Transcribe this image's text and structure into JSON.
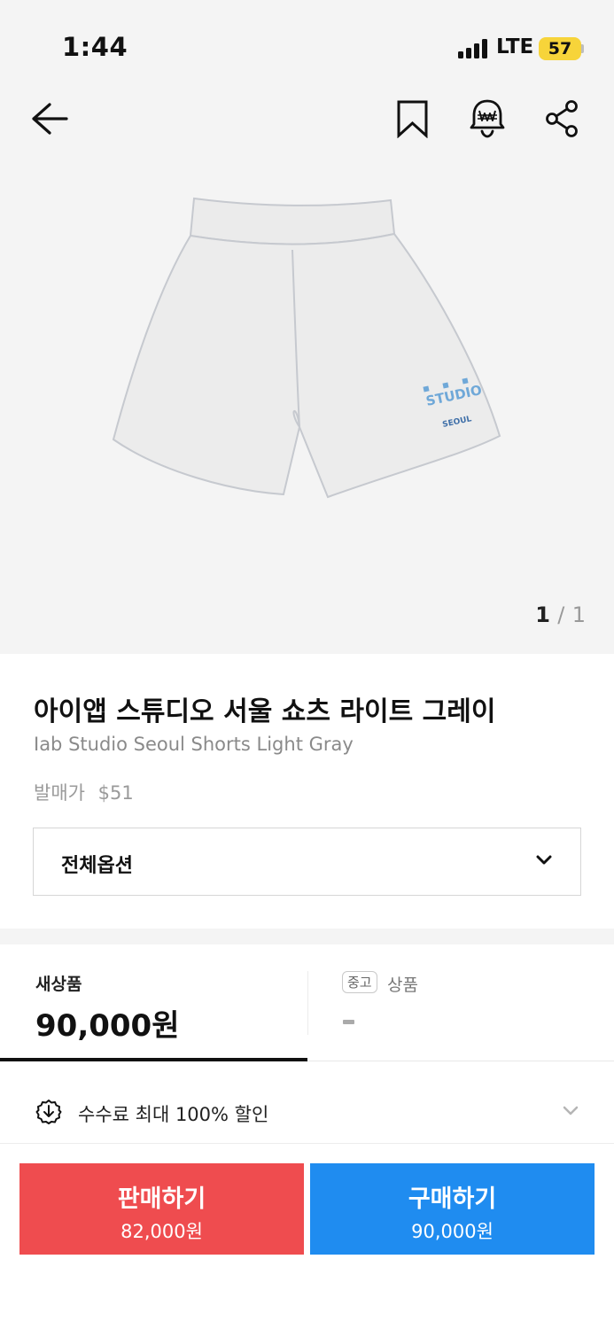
{
  "status_bar": {
    "time": "1:44",
    "network": "LTE",
    "battery": "57"
  },
  "nav": {
    "back_icon": "arrow-left-icon",
    "bookmark_icon": "bookmark-icon",
    "alert_icon": "price-alert-bell-icon",
    "share_icon": "share-icon"
  },
  "gallery": {
    "current": "1",
    "separator": "/",
    "total": "1",
    "image": "light-gray-shorts-photo",
    "print_text": "STUDIO",
    "print_sub": "SEOUL"
  },
  "product": {
    "title_ko": "아이앱 스튜디오 서울 쇼츠 라이트 그레이",
    "title_en": "Iab Studio Seoul Shorts Light Gray",
    "release_label": "발매가",
    "release_price": "$51"
  },
  "options": {
    "label": "전체옵션",
    "icon": "chevron-down-icon"
  },
  "tabs": {
    "new": {
      "label": "새상품",
      "price": "90,000원"
    },
    "used": {
      "badge": "중고",
      "label": "상품",
      "price": "-"
    }
  },
  "fee": {
    "icon": "discount-download-icon",
    "text": "수수료 최대 100% 할인",
    "chevron": "chevron-down-icon"
  },
  "actions": {
    "sell_label": "판매하기",
    "sell_price": "82,000원",
    "buy_label": "구매하기",
    "buy_price": "90,000원"
  },
  "colors": {
    "sell": "#ef4c4f",
    "buy": "#1f8cf0",
    "battery": "#f7d43a",
    "print_blue": "#6fa8d8"
  }
}
